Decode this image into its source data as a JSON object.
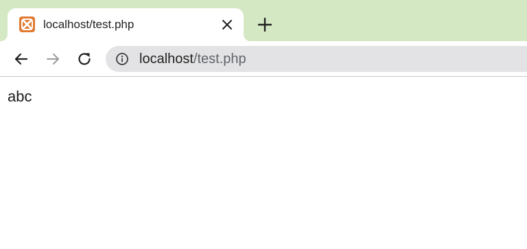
{
  "browser": {
    "tab": {
      "title": "localhost/test.php",
      "favicon": "xampp-icon",
      "close_icon": "close-icon"
    },
    "new_tab_icon": "plus-icon",
    "toolbar": {
      "back_icon": "back-arrow-icon",
      "forward_icon": "forward-arrow-icon",
      "reload_icon": "reload-icon",
      "site_info_icon": "info-icon"
    },
    "address": {
      "host": "localhost",
      "path": "/test.php"
    },
    "colors": {
      "tabstrip_bg": "#d4e8c4",
      "omnibox_bg": "#e3e3e5",
      "favicon_bg": "#e07a30"
    }
  },
  "page": {
    "body_text": "abc"
  }
}
